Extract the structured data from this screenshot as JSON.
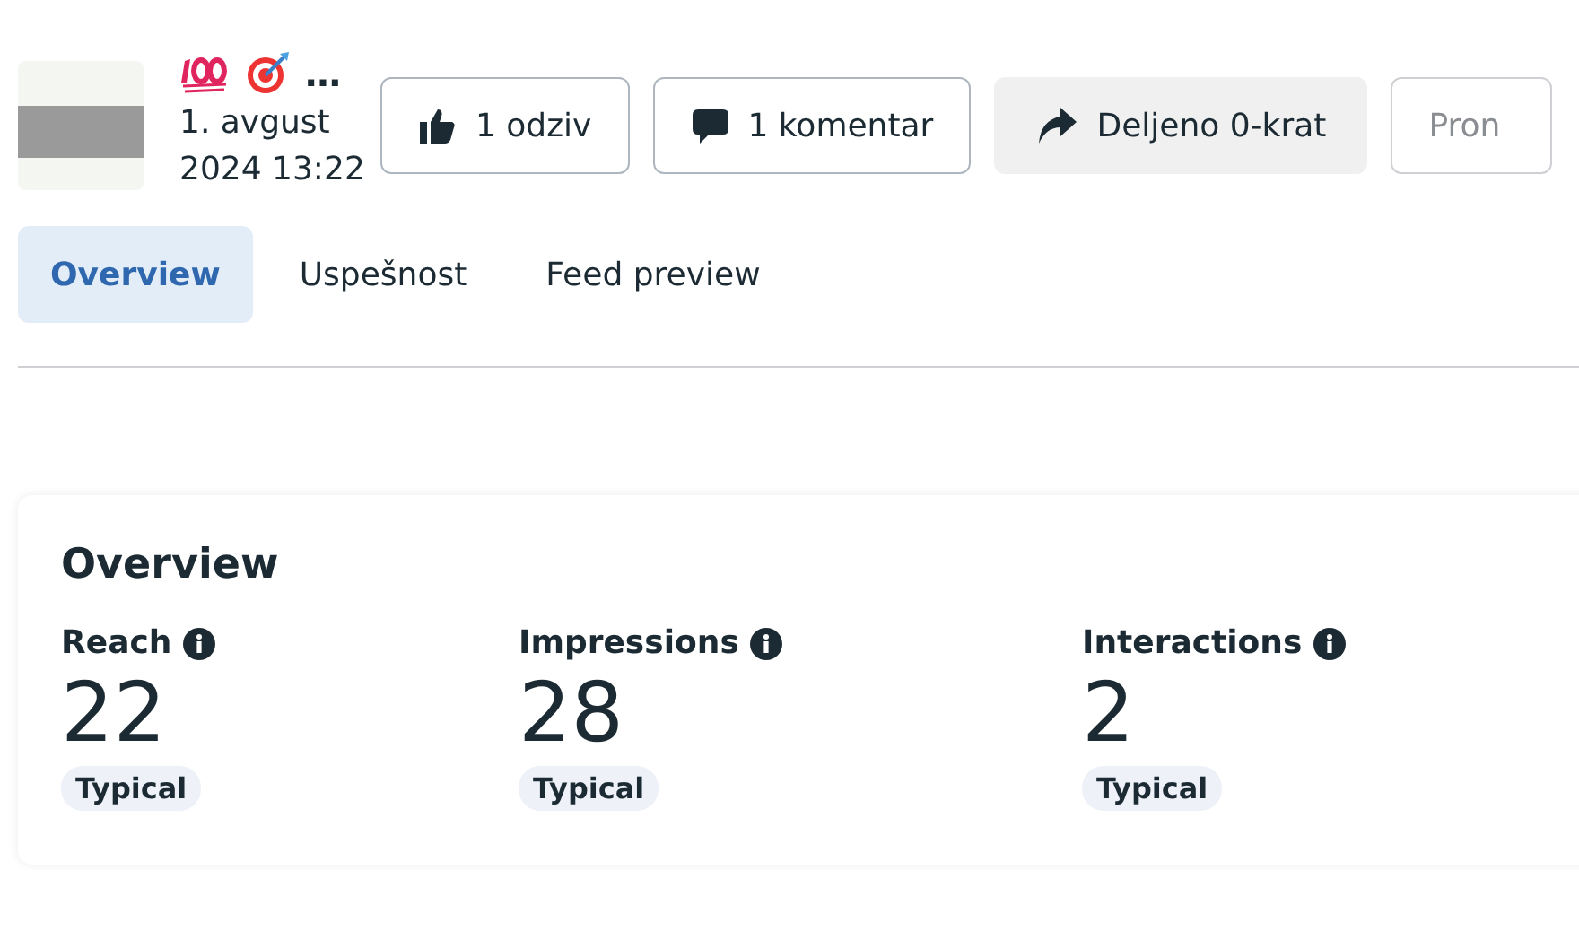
{
  "post": {
    "more": "…",
    "date": "1. avgust",
    "time": "2024 13:22"
  },
  "actions": [
    {
      "kind": "like",
      "label": "1 odziv"
    },
    {
      "kind": "comment",
      "label": "1 komentar"
    },
    {
      "kind": "share",
      "label": "Deljeno 0-krat"
    },
    {
      "kind": "promote",
      "label": "Pron"
    }
  ],
  "tabs": [
    {
      "label": "Overview",
      "selected": true
    },
    {
      "label": "Uspešnost",
      "selected": false
    },
    {
      "label": "Feed preview",
      "selected": false
    }
  ],
  "overview": {
    "title": "Overview",
    "metrics": [
      {
        "label": "Reach",
        "value": "22",
        "badge": "Typical"
      },
      {
        "label": "Impressions",
        "value": "28",
        "badge": "Typical"
      },
      {
        "label": "Interactions",
        "value": "2",
        "badge": "Typical"
      }
    ]
  }
}
